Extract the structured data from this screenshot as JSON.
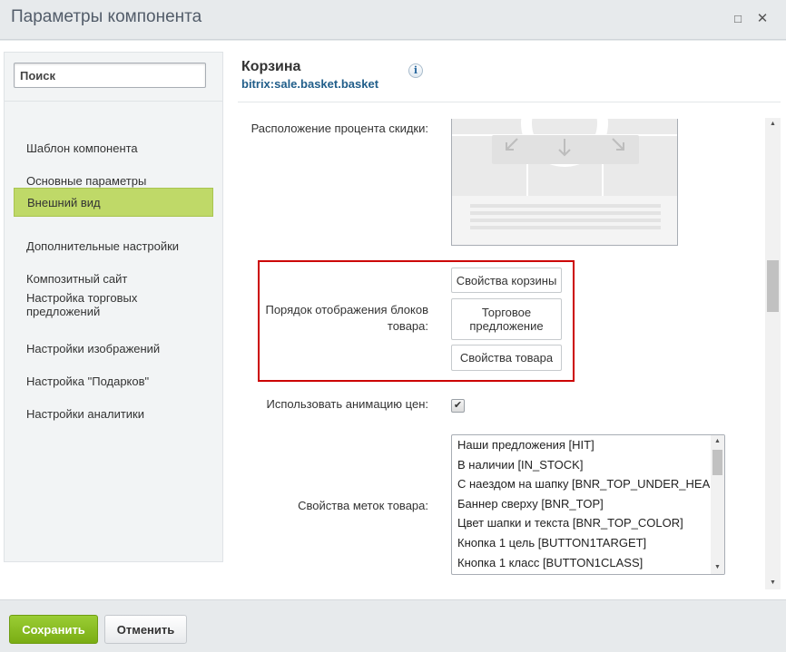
{
  "window": {
    "title": "Параметры компонента",
    "maximize_icon": "□",
    "close_icon": "✕"
  },
  "sidebar": {
    "search_placeholder": "Поиск",
    "items": [
      {
        "label": "Шаблон компонента",
        "active": false
      },
      {
        "label": "Основные параметры",
        "active": false
      },
      {
        "label": "Внешний вид",
        "active": true
      },
      {
        "label": "Дополнительные настройки",
        "active": false
      },
      {
        "label": "Композитный сайт",
        "active": false
      },
      {
        "label": "Настройка торговых предложений",
        "active": false
      },
      {
        "label": "Настройки изображений",
        "active": false
      },
      {
        "label": "Настройка \"Подарков\"",
        "active": false
      },
      {
        "label": "Настройки аналитики",
        "active": false
      }
    ]
  },
  "component": {
    "title": "Корзина",
    "id": "bitrix:sale.basket.basket",
    "info_icon": "i"
  },
  "props": {
    "discount_position_label": "Расположение процента скидки:",
    "block_order_label": "Порядок отображения блоков товара:",
    "block_order_items": [
      "Свойства корзины",
      "Торговое предложение",
      "Свойства товара"
    ],
    "animation_label": "Использовать анимацию цен:",
    "animation_checked": true,
    "animation_check_icon": "✔",
    "labels_label": "Свойства меток товара:",
    "labels_options": [
      "Наши предложения [HIT]",
      "В наличии [IN_STOCK]",
      "С наездом на шапку [BNR_TOP_UNDER_HEADER]",
      "Баннер сверху [BNR_TOP]",
      "Цвет шапки и текста [BNR_TOP_COLOR]",
      "Кнопка 1 цель [BUTTON1TARGET]",
      "Кнопка 1 класс [BUTTON1CLASS]"
    ]
  },
  "footer": {
    "save_label": "Сохранить",
    "cancel_label": "Отменить"
  },
  "colors": {
    "active_nav": "#bfd968",
    "save_button": "#8cc220",
    "highlight_border": "#cc0000",
    "component_id": "#215e8a"
  }
}
